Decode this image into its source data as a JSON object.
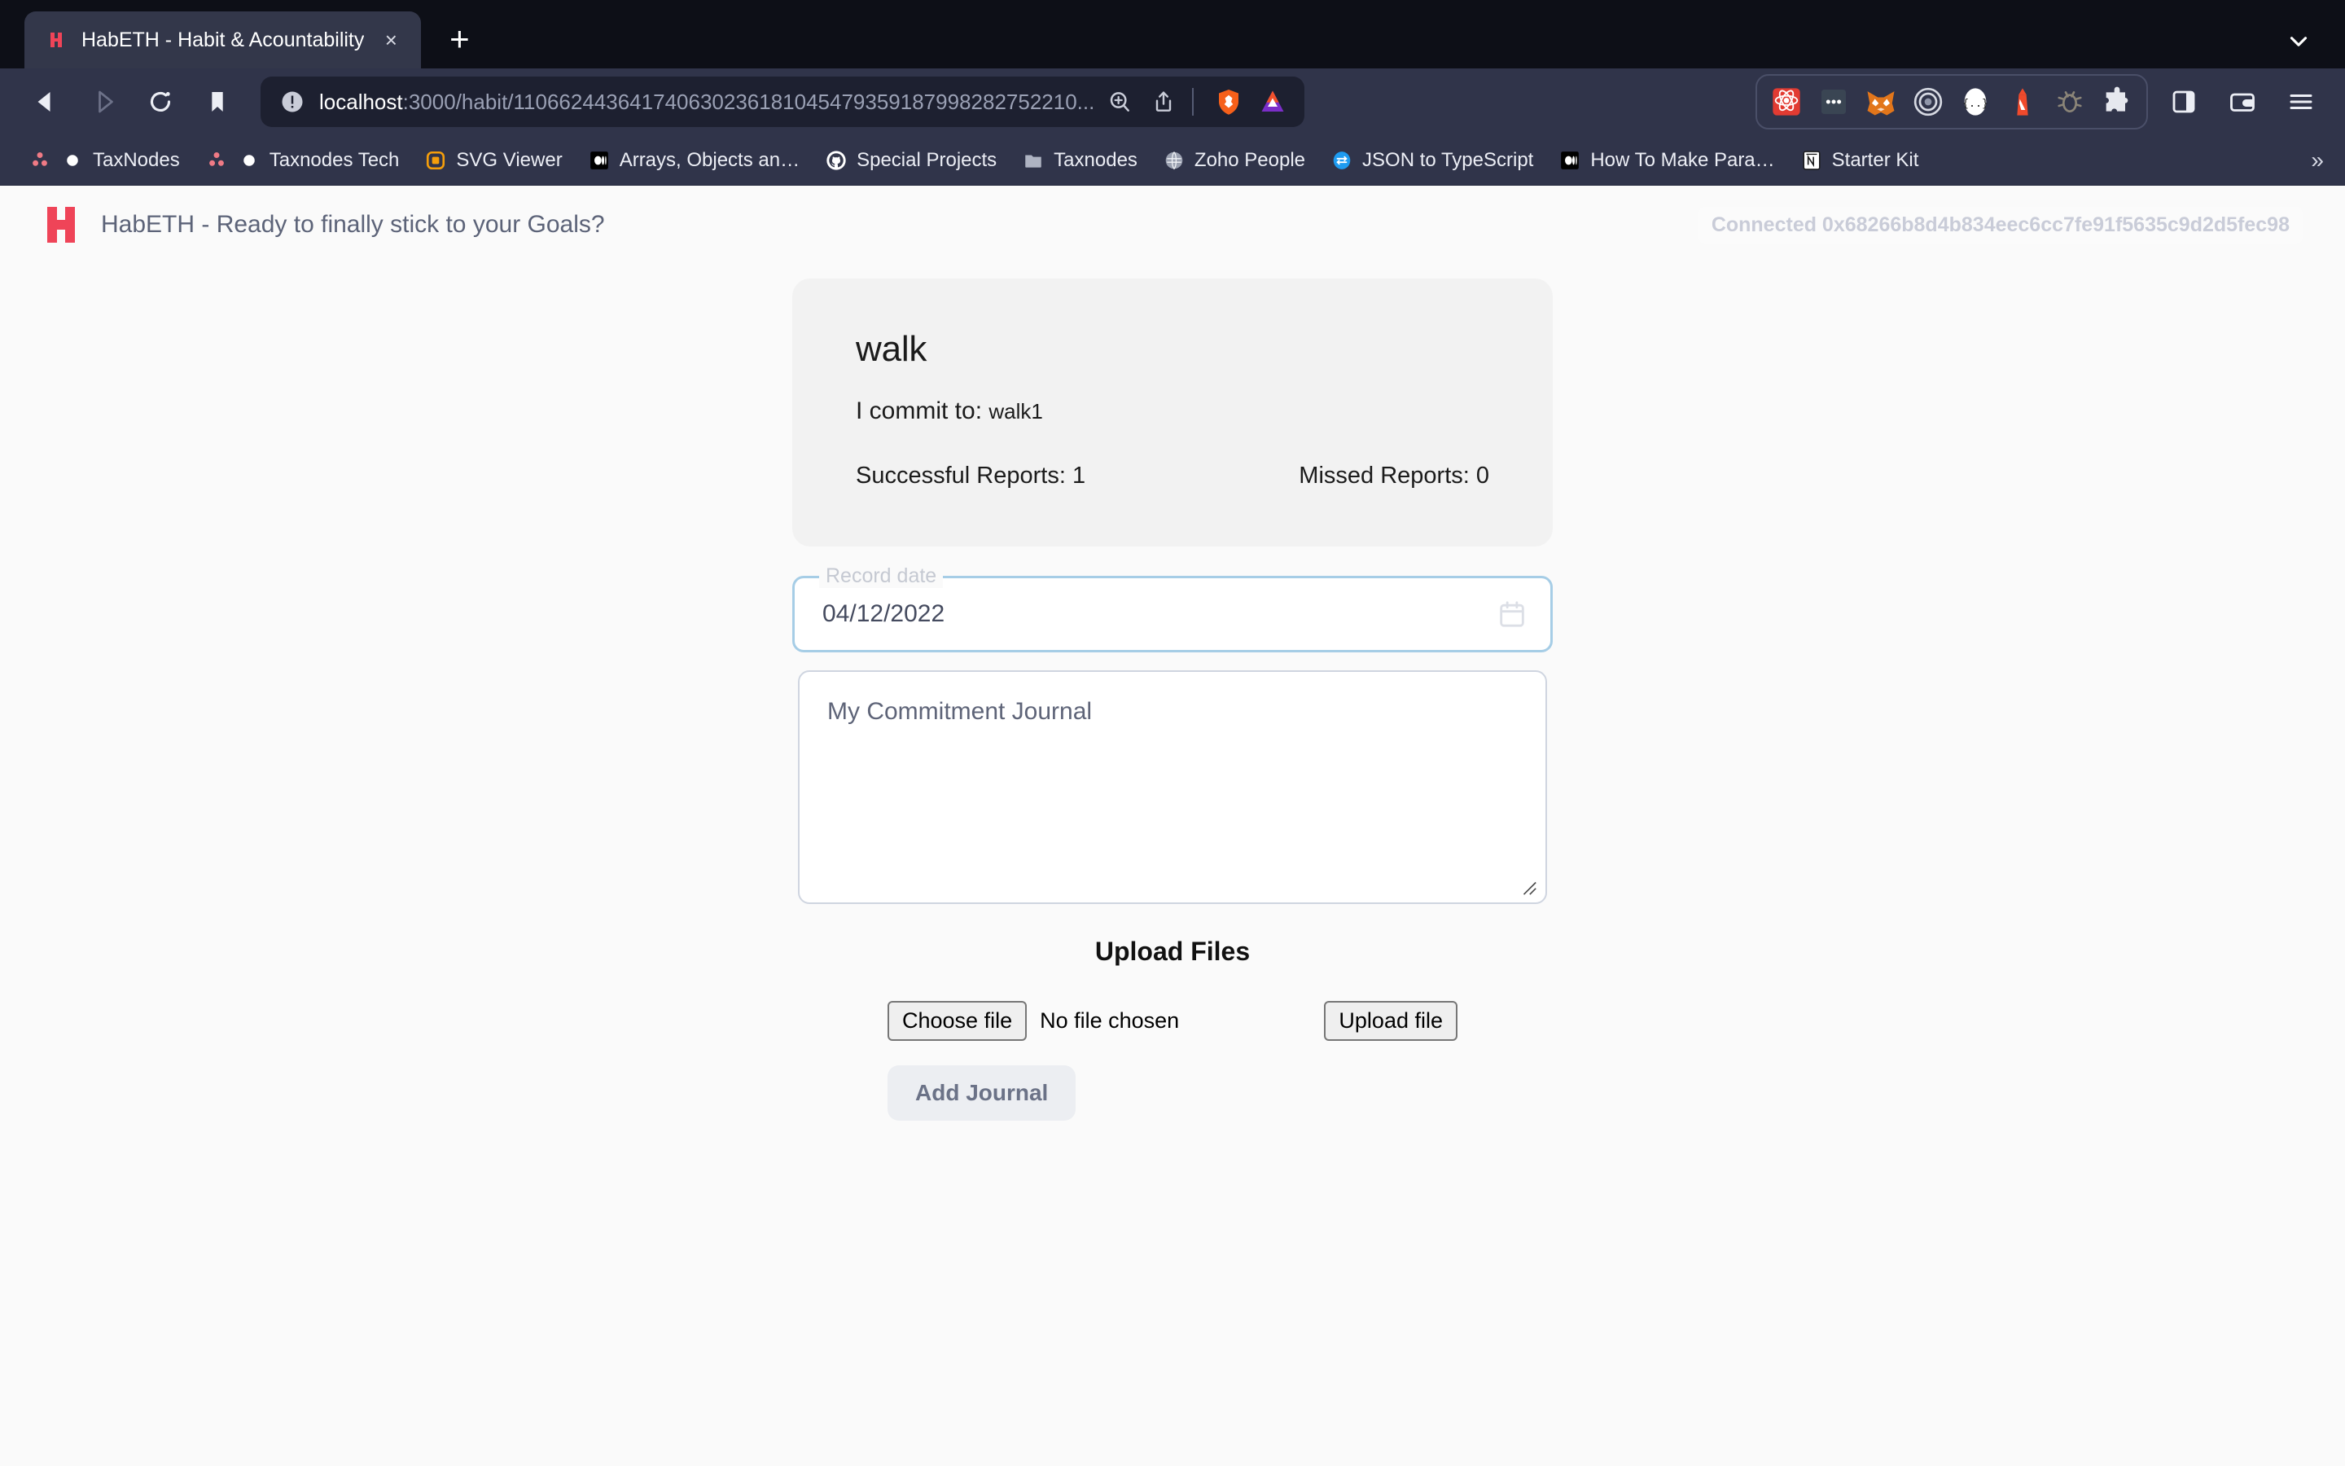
{
  "browser": {
    "tab": {
      "title": "HabETH - Habit & Acountability",
      "favicon_name": "habeth-favicon",
      "close_label": "×",
      "newtab_label": "+"
    },
    "nav": {
      "back_icon": "back-arrow-icon",
      "forward_icon": "forward-arrow-icon",
      "reload_icon": "reload-icon",
      "bookmark_icon": "bookmark-icon"
    },
    "url": {
      "host": "localhost",
      "path": ":3000/habit/110662443641740630236181045479359187998282752210...",
      "info_icon": "site-info-icon",
      "zoom_icon": "zoom-in-icon",
      "share_icon": "share-icon",
      "brave_icon": "brave-shields-icon",
      "bat_icon": "brave-rewards-icon"
    },
    "extensions": [
      {
        "name": "react-devtools-icon"
      },
      {
        "name": "redux-devtools-icon"
      },
      {
        "name": "metamask-icon"
      },
      {
        "name": "target-rings-icon"
      },
      {
        "name": "json-formatter-icon"
      },
      {
        "name": "lighthouse-icon"
      },
      {
        "name": "bug-debugger-icon"
      },
      {
        "name": "puzzle-extensions-icon"
      }
    ],
    "tools": [
      {
        "name": "sidebar-toggle-icon"
      },
      {
        "name": "wallet-icon"
      },
      {
        "name": "browser-menu-icon"
      }
    ],
    "tab_search_icon": "chevron-down-icon",
    "bookmarks": [
      {
        "label": "TaxNodes",
        "icon": "taxnodes-icon"
      },
      {
        "label": "Taxnodes Tech",
        "icon": "taxnodes-icon"
      },
      {
        "label": "SVG Viewer",
        "icon": "svg-viewer-icon"
      },
      {
        "label": "Arrays, Objects an…",
        "icon": "medium-icon"
      },
      {
        "label": "Special Projects",
        "icon": "github-icon"
      },
      {
        "label": "Taxnodes",
        "icon": "folder-icon"
      },
      {
        "label": "Zoho People",
        "icon": "zoho-icon"
      },
      {
        "label": "JSON to TypeScript",
        "icon": "transform-icon"
      },
      {
        "label": "How To Make Para…",
        "icon": "medium-icon"
      },
      {
        "label": "Starter Kit",
        "icon": "notion-icon"
      }
    ],
    "bookmarks_overflow": "»"
  },
  "app": {
    "logo_name": "habeth-logo",
    "title": "HabETH - Ready to finally stick to your Goals?",
    "wallet_status": "Connected 0x68266b8d4b834eec6cc7fe91f5635c9d2d5fec98"
  },
  "habit": {
    "name": "walk",
    "commit_label": "I commit to:",
    "commit_value": "walk1",
    "successful_reports": "Successful Reports: 1",
    "missed_reports": "Missed Reports: 0"
  },
  "form": {
    "date_label": "Record date",
    "date_value": "04/12/2022",
    "calendar_icon": "calendar-icon",
    "journal_placeholder": "My Commitment Journal",
    "resize_icon": "resize-handle-icon"
  },
  "upload": {
    "title": "Upload Files",
    "choose_file_label": "Choose file",
    "no_file_label": "No file chosen",
    "upload_button_label": "Upload file",
    "add_journal_label": "Add Journal"
  },
  "colors": {
    "brand_red": "#ef4458",
    "chrome_dark": "#30344a",
    "tabstrip_dark": "#0d0f17",
    "card_gray": "#f2f2f2",
    "date_border_blue": "#a6cde6",
    "page_bg": "#fafafa"
  }
}
